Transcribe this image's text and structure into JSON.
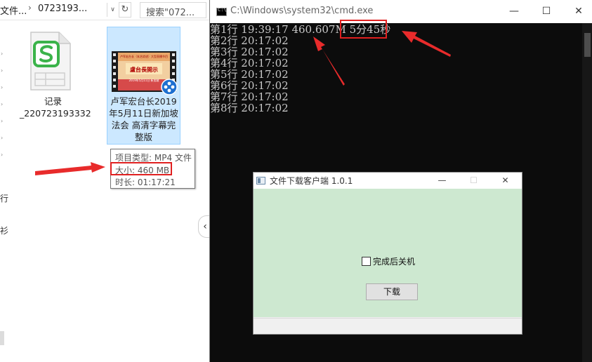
{
  "explorer": {
    "breadcrumb": [
      "文件...",
      "0723193..."
    ],
    "search_placeholder": "搜索\"072...",
    "nav_fragments": [
      "行",
      "衫"
    ],
    "files": [
      {
        "name": "记录\n_220723193332",
        "type": "spreadsheet"
      },
      {
        "name": "卢军宏台长2019年5月11日新加坡法会 高清字幕完整版",
        "type": "video"
      }
    ],
    "video_thumb_text": [
      "卢军宏台长（玄艺综述）大型直播节目",
      "盧台長開示",
      "2019年5月11日 新加坡"
    ],
    "tooltip": {
      "type_line": "项目类型: MP4 文件",
      "size_line": "大小: 460 MB",
      "duration_line": "时长: 01:17:21"
    }
  },
  "cmd": {
    "title": "C:\\Windows\\system32\\cmd.exe",
    "lines": [
      {
        "prefix": "第1行 19:39:17 460.607M ",
        "highlight": "5分45秒"
      },
      {
        "prefix": "第2行 20:17:02",
        "highlight": ""
      },
      {
        "prefix": "第3行 20:17:02",
        "highlight": ""
      },
      {
        "prefix": "第4行 20:17:02",
        "highlight": ""
      },
      {
        "prefix": "第5行 20:17:02",
        "highlight": ""
      },
      {
        "prefix": "第6行 20:17:02",
        "highlight": ""
      },
      {
        "prefix": "第7行 20:17:02",
        "highlight": ""
      },
      {
        "prefix": "第8行 20:17:02",
        "highlight": ""
      }
    ]
  },
  "dialog": {
    "title": "文件下载客户端 1.0.1",
    "checkbox_label": "完成后关机",
    "checkbox_checked": false,
    "download_button": "下载",
    "client_color": "#cde8d0"
  },
  "window_controls": {
    "minimize": "—",
    "maximize": "☐",
    "close": "✕"
  },
  "colors": {
    "annotation": "#e02020",
    "selection": "#cce8ff",
    "console_bg": "#0c0c0c"
  }
}
